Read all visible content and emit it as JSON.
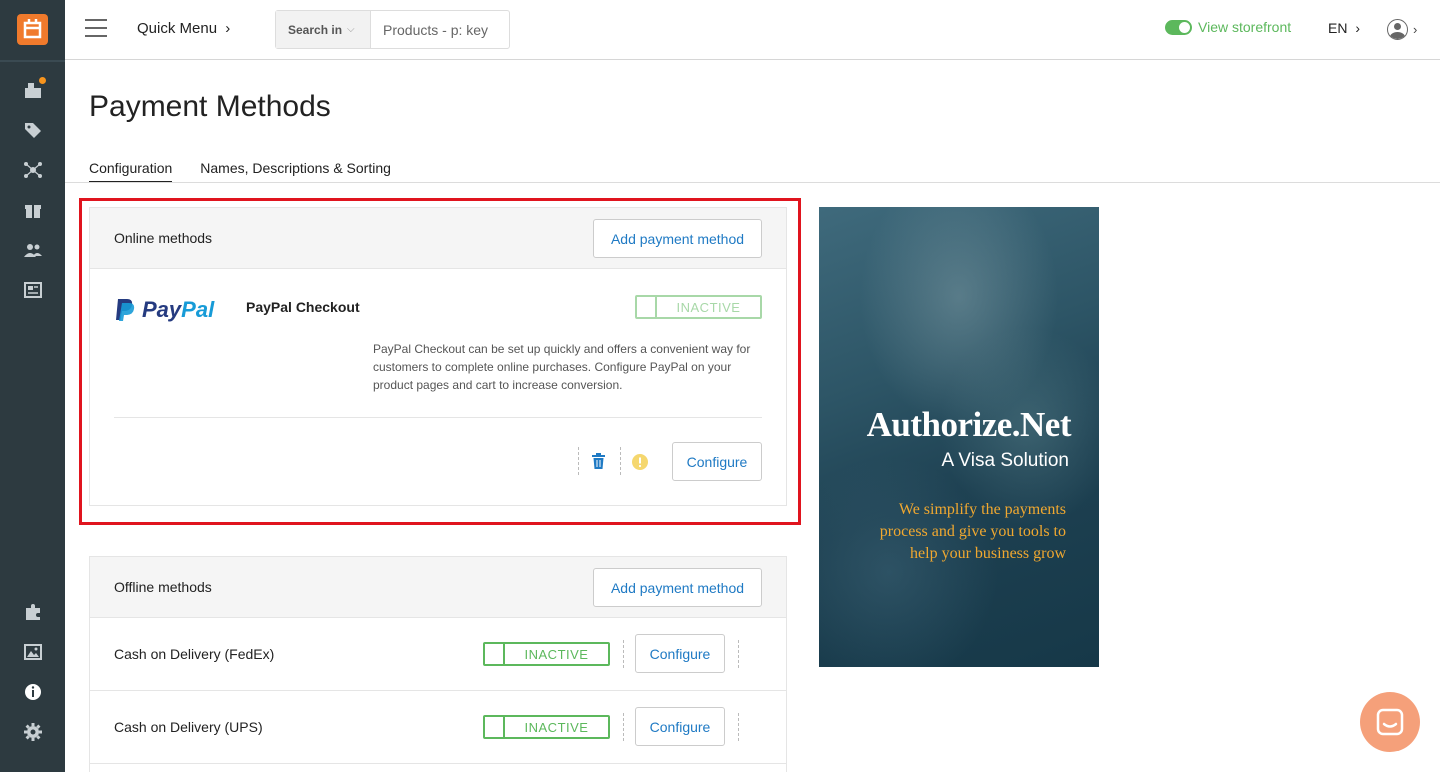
{
  "topbar": {
    "quick_menu": "Quick Menu",
    "search_in_label": "Search in",
    "search_placeholder": "Products - p: key",
    "view_storefront": "View storefront",
    "language": "EN"
  },
  "sidebar": {
    "top_icons": [
      "dashboard-icon",
      "tags-icon",
      "network-icon",
      "gift-icon",
      "users-icon",
      "news-icon"
    ],
    "bottom_icons": [
      "puzzle-icon",
      "image-icon",
      "info-icon",
      "gear-icon"
    ]
  },
  "page": {
    "title": "Payment Methods",
    "tabs": [
      {
        "label": "Configuration",
        "active": true
      },
      {
        "label": "Names, Descriptions & Sorting",
        "active": false
      }
    ]
  },
  "online": {
    "title": "Online methods",
    "add_label": "Add payment method",
    "method": {
      "logo_pay": "Pay",
      "logo_pal": "Pal",
      "name": "PayPal Checkout",
      "status": "INACTIVE",
      "description": "PayPal Checkout can be set up quickly and offers a convenient way for customers to complete online purchases. Configure PayPal on your product pages and cart to increase conversion.",
      "configure_label": "Configure"
    }
  },
  "offline": {
    "title": "Offline methods",
    "add_label": "Add payment method",
    "rows": [
      {
        "name": "Cash on Delivery (FedEx)",
        "status": "INACTIVE",
        "configure_label": "Configure"
      },
      {
        "name": "Cash on Delivery (UPS)",
        "status": "INACTIVE",
        "configure_label": "Configure"
      }
    ]
  },
  "ad": {
    "brand": "Authorize.Net",
    "subtitle": "A Visa Solution",
    "tagline_1": "We simplify the payments",
    "tagline_2": "process and give you tools to",
    "tagline_3": "help your business grow"
  },
  "colors": {
    "sidebar": "#2d3a40",
    "accent": "#f07a2c",
    "link": "#1f7ac4",
    "status_green": "#5cb85c",
    "highlight": "#e0141e"
  }
}
